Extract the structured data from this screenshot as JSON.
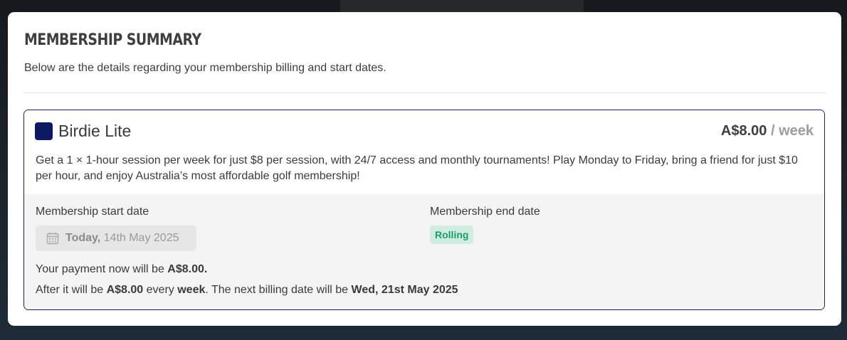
{
  "summary": {
    "title": "MEMBERSHIP SUMMARY",
    "subtitle": "Below are the details regarding your membership billing and start dates."
  },
  "plan": {
    "name": "Birdie Lite",
    "color": "#0b1a63",
    "price": "A$8.00",
    "period": "/ week",
    "description": "Get a 1 × 1-hour session per week for just $8 per session, with 24/7 access and monthly tournaments! Play Monday to Friday, bring a friend for just $10 per hour, and enjoy Australia’s most affordable golf membership!"
  },
  "dates": {
    "start_label": "Membership start date",
    "start_day": "Today,",
    "start_date": "14th May 2025",
    "end_label": "Membership end date",
    "end_badge": "Rolling",
    "badge_color": "#1b9d6a"
  },
  "payment": {
    "now_prefix": "Your payment now will be",
    "now_amount": "A$8.00.",
    "after_prefix": "After it will be",
    "after_amount": "A$8.00",
    "after_mid": "every",
    "after_period": "week",
    "after_suffix": ". The next billing date will be",
    "next_date": "Wed, 21st May 2025"
  }
}
